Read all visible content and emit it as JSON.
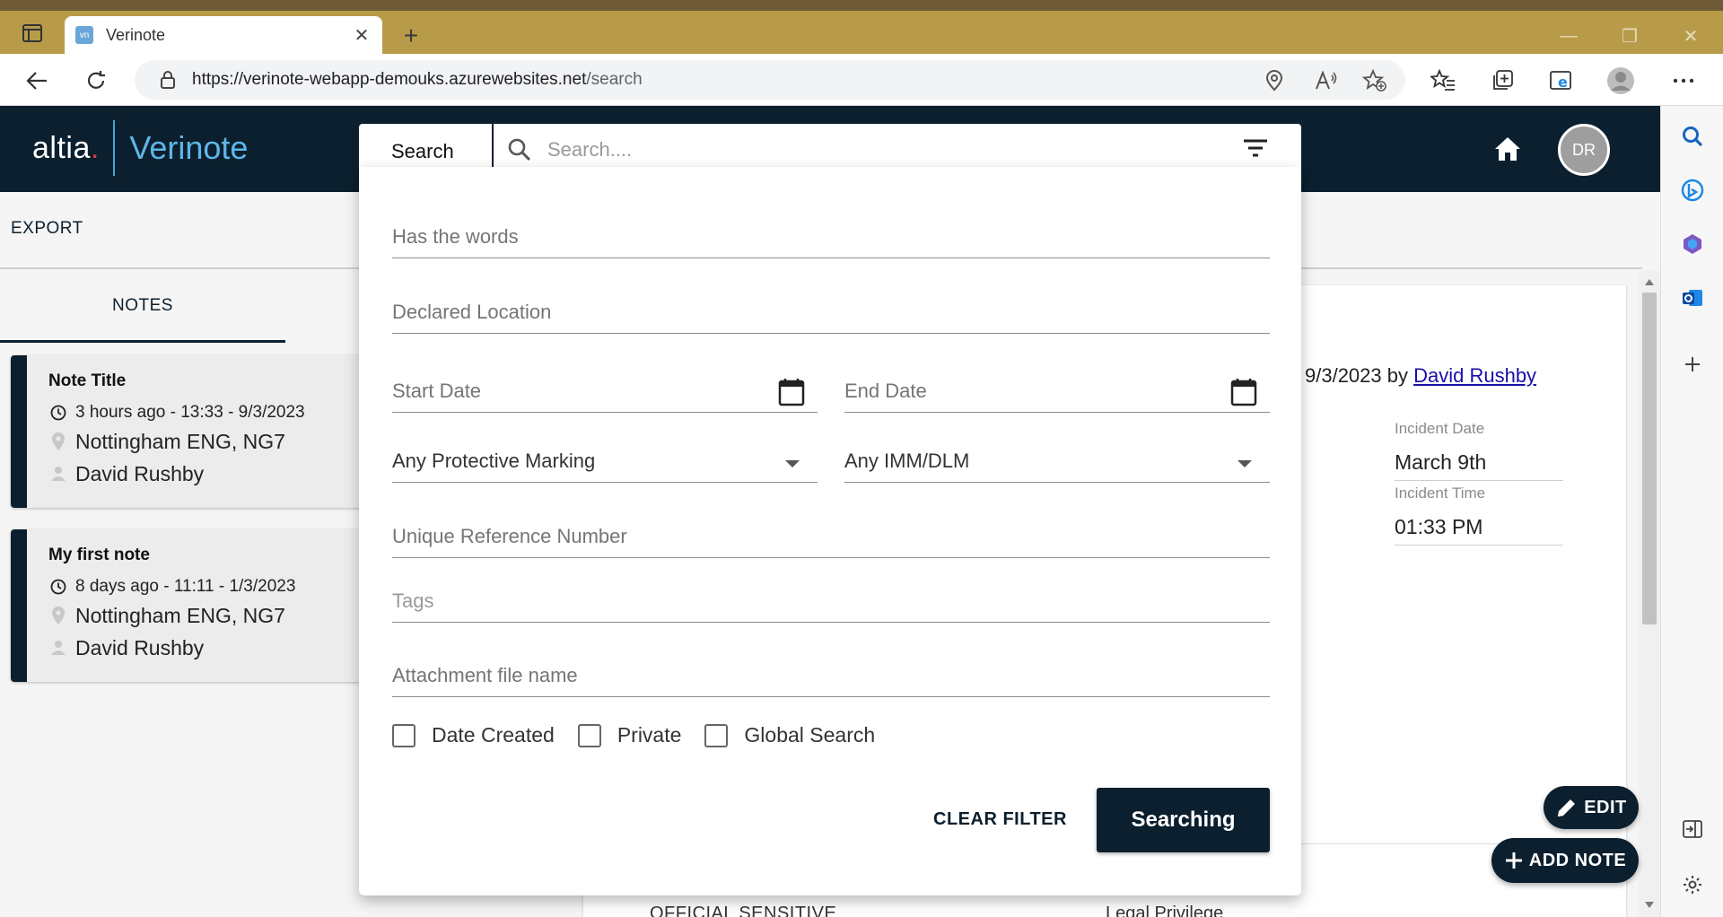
{
  "browser": {
    "tab_title": "Verinote",
    "tab_favicon_text": "vn",
    "url_host": "https://verinote-webapp-demouks.azurewebsites.net",
    "url_path": "/search"
  },
  "header": {
    "logo_brand": "altia",
    "logo_dot": ".",
    "logo_product": "Verinote",
    "avatar_initials": "DR"
  },
  "toolbar": {
    "export_label": "EXPORT"
  },
  "tabs": {
    "notes_label": "NOTES"
  },
  "notes": [
    {
      "title": "Note Title",
      "time": "3 hours ago - 13:33 - 9/3/2023",
      "location": "Nottingham ENG, NG7",
      "author": "David Rushby"
    },
    {
      "title": "My first note",
      "time": "8 days ago - 11:11 - 1/3/2023",
      "location": "Nottingham ENG, NG7",
      "author": "David Rushby"
    }
  ],
  "detail": {
    "meta_prefix": "9/3/2023 by ",
    "meta_author": "David Rushby",
    "incident_date_label": "Incident Date",
    "incident_date_value": "March 9th",
    "incident_time_label": "Incident Time",
    "incident_time_value": "01:33 PM",
    "bottom_left": "OFFICIAL SENSITIVE",
    "bottom_right": "Legal Privilege"
  },
  "search": {
    "label": "Search",
    "placeholder": "Search....",
    "filters": {
      "has_words": "Has the words",
      "declared_location": "Declared Location",
      "start_date": "Start Date",
      "end_date": "End Date",
      "protective_marking": "Any Protective Marking",
      "imm_dlm": "Any IMM/DLM",
      "unique_ref": "Unique Reference Number",
      "tags": "Tags",
      "attachment": "Attachment file name"
    },
    "checkboxes": {
      "date_created": "Date Created",
      "private": "Private",
      "global_search": "Global Search"
    },
    "clear_filter": "CLEAR FILTER",
    "submit": "Searching"
  },
  "fabs": {
    "edit": "EDIT",
    "add_note": "ADD NOTE"
  },
  "colors": {
    "navy": "#0b1f2e",
    "chrome_tabbar": "#b79b48",
    "accent_blue": "#5fb6e6",
    "logo_dot": "#d9344c"
  }
}
